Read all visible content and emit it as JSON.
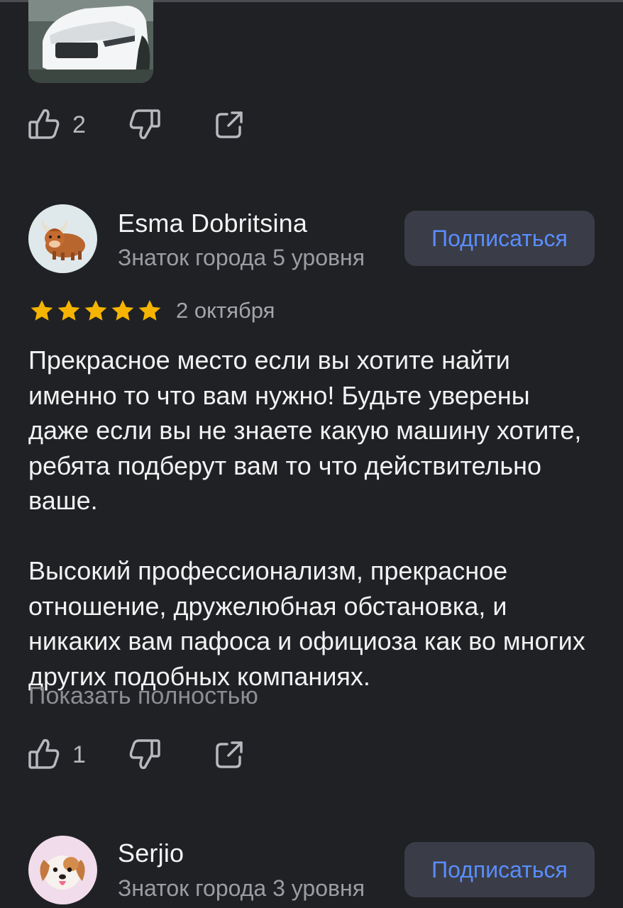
{
  "colors": {
    "background": "#202125",
    "accent": "#5a8dff",
    "star": "#f5b400",
    "muted_text": "#9c9da3",
    "button_bg": "#3a3d47"
  },
  "reviews": [
    {
      "likes": "2",
      "icons": [
        "thumbs-up-icon",
        "thumbs-down-icon",
        "share-icon"
      ]
    },
    {
      "author": "Esma Dobritsina",
      "level": "Знаток города 5 уровня",
      "subscribe_label": "Подписаться",
      "rating": 5,
      "date": "2 октября",
      "paragraphs": [
        "Прекрасное место если вы хотите найти именно то что вам нужно! Будьте уверены даже если вы не знаете какую машину хотите, ребята подберут вам то что действительно ваше.",
        "Высокий профессионализм, прекрасное отношение, дружелюбная обстановка, и никаких вам пафоса и официоза как во многих других подобных компаниях."
      ],
      "show_more": "Показать полностью",
      "likes": "1"
    },
    {
      "author": "Serjio",
      "level": "Знаток города 3 уровня",
      "subscribe_label": "Подписаться"
    }
  ]
}
